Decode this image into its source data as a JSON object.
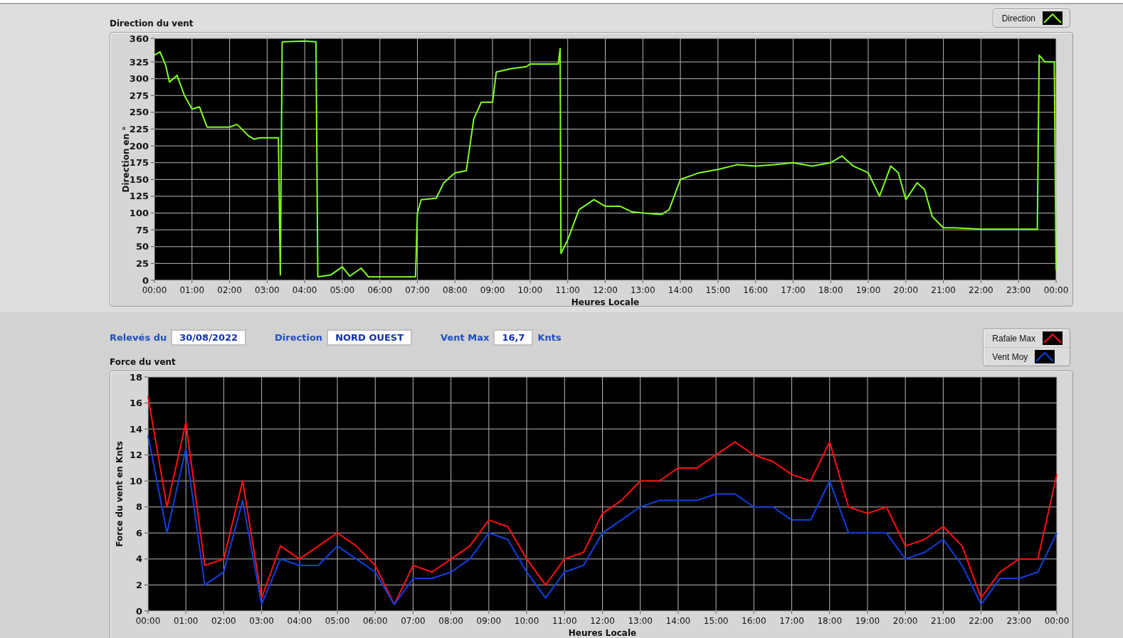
{
  "direction_chart": {
    "title": "Direction du vent",
    "chart_data": {
      "type": "line",
      "grid": true,
      "xlabel": "Heures Locale",
      "ylabel": "Direction en °",
      "xlim": [
        0,
        24
      ],
      "ylim": [
        0,
        360
      ],
      "yticks": [
        0,
        25,
        50,
        75,
        100,
        125,
        150,
        175,
        200,
        225,
        250,
        275,
        300,
        325,
        360
      ],
      "xticks": [
        {
          "value": 0,
          "label": "00:00"
        },
        {
          "value": 1,
          "label": "01:00"
        },
        {
          "value": 2,
          "label": "02:00"
        },
        {
          "value": 3,
          "label": "03:00"
        },
        {
          "value": 4,
          "label": "04:00"
        },
        {
          "value": 5,
          "label": "05:00"
        },
        {
          "value": 6,
          "label": "06:00"
        },
        {
          "value": 7,
          "label": "07:00"
        },
        {
          "value": 8,
          "label": "08:00"
        },
        {
          "value": 9,
          "label": "09:00"
        },
        {
          "value": 10,
          "label": "10:00"
        },
        {
          "value": 11,
          "label": "11:00"
        },
        {
          "value": 12,
          "label": "12:00"
        },
        {
          "value": 13,
          "label": "13:00"
        },
        {
          "value": 14,
          "label": "14:00"
        },
        {
          "value": 15,
          "label": "15:00"
        },
        {
          "value": 16,
          "label": "16:00"
        },
        {
          "value": 17,
          "label": "17:00"
        },
        {
          "value": 18,
          "label": "18:00"
        },
        {
          "value": 19,
          "label": "19:00"
        },
        {
          "value": 20,
          "label": "20:00"
        },
        {
          "value": 21,
          "label": "21:00"
        },
        {
          "value": 22,
          "label": "22:00"
        },
        {
          "value": 23,
          "label": "23:00"
        },
        {
          "value": 24,
          "label": "00:00"
        }
      ],
      "x": [
        0,
        0.15,
        0.3,
        0.4,
        0.6,
        0.8,
        1.0,
        1.2,
        1.4,
        2.0,
        2.2,
        2.5,
        2.65,
        2.8,
        3.3,
        3.35,
        3.4,
        4.0,
        4.3,
        4.35,
        4.7,
        5.0,
        5.2,
        5.5,
        5.7,
        6.95,
        7.0,
        7.1,
        7.5,
        7.7,
        8.0,
        8.3,
        8.5,
        8.7,
        9.0,
        9.1,
        9.5,
        9.9,
        10.0,
        10.75,
        10.8,
        10.82,
        11.0,
        11.3,
        11.7,
        12.0,
        12.4,
        12.7,
        13.0,
        13.5,
        13.7,
        14.0,
        14.5,
        15.0,
        15.5,
        16.0,
        16.5,
        17.0,
        17.5,
        18.0,
        18.3,
        18.6,
        19.0,
        19.3,
        19.6,
        19.8,
        20.0,
        20.3,
        20.5,
        20.7,
        21.0,
        21.3,
        22.0,
        23.0,
        23.5,
        23.55,
        23.7,
        23.95,
        24.0
      ],
      "series": [
        {
          "name": "Direction",
          "color": "#80ff20",
          "values": [
            335,
            340,
            320,
            295,
            305,
            275,
            255,
            258,
            228,
            228,
            232,
            215,
            210,
            212,
            212,
            8,
            355,
            356,
            355,
            5,
            8,
            20,
            6,
            18,
            5,
            5,
            100,
            120,
            122,
            145,
            160,
            163,
            240,
            265,
            265,
            310,
            315,
            318,
            322,
            322,
            345,
            40,
            60,
            105,
            120,
            110,
            110,
            102,
            100,
            98,
            105,
            150,
            160,
            165,
            172,
            170,
            172,
            175,
            170,
            175,
            185,
            170,
            160,
            125,
            170,
            160,
            120,
            145,
            135,
            95,
            78,
            78,
            76,
            76,
            76,
            335,
            325,
            325,
            15
          ]
        }
      ]
    }
  },
  "summary": {
    "fields": [
      {
        "label": "Relevés du",
        "value": "30/08/2022"
      },
      {
        "label": "Direction",
        "value": "NORD OUEST"
      },
      {
        "label": "Vent Max",
        "value": "16,7",
        "unit": "Knts"
      }
    ]
  },
  "force_chart": {
    "title": "Force du vent",
    "chart_data": {
      "type": "line",
      "grid": true,
      "xlabel": "Heures Locale",
      "ylabel": "Force du vent en Knts",
      "xlim": [
        0,
        24
      ],
      "ylim": [
        0,
        18
      ],
      "yticks": [
        0,
        2,
        4,
        6,
        8,
        10,
        12,
        14,
        16,
        18
      ],
      "xticks": [
        {
          "value": 0,
          "label": "00:00"
        },
        {
          "value": 1,
          "label": "01:00"
        },
        {
          "value": 2,
          "label": "02:00"
        },
        {
          "value": 3,
          "label": "03:00"
        },
        {
          "value": 4,
          "label": "04:00"
        },
        {
          "value": 5,
          "label": "05:00"
        },
        {
          "value": 6,
          "label": "06:00"
        },
        {
          "value": 7,
          "label": "07:00"
        },
        {
          "value": 8,
          "label": "08:00"
        },
        {
          "value": 9,
          "label": "09:00"
        },
        {
          "value": 10,
          "label": "10:00"
        },
        {
          "value": 11,
          "label": "11:00"
        },
        {
          "value": 12,
          "label": "12:00"
        },
        {
          "value": 13,
          "label": "13:00"
        },
        {
          "value": 14,
          "label": "14:00"
        },
        {
          "value": 15,
          "label": "15:00"
        },
        {
          "value": 16,
          "label": "16:00"
        },
        {
          "value": 17,
          "label": "17:00"
        },
        {
          "value": 18,
          "label": "18:00"
        },
        {
          "value": 19,
          "label": "19:00"
        },
        {
          "value": 20,
          "label": "20:00"
        },
        {
          "value": 21,
          "label": "21:00"
        },
        {
          "value": 22,
          "label": "22:00"
        },
        {
          "value": 23,
          "label": "23:00"
        },
        {
          "value": 24,
          "label": "00:00"
        }
      ],
      "x": [
        0,
        0.5,
        1,
        1.5,
        2,
        2.5,
        3,
        3.5,
        4,
        4.5,
        5,
        5.5,
        6,
        6.5,
        7,
        7.5,
        8,
        8.5,
        9,
        9.5,
        10,
        10.5,
        11,
        11.5,
        12,
        12.5,
        13,
        13.5,
        14,
        14.5,
        15,
        15.5,
        16,
        16.5,
        17,
        17.5,
        18,
        18.5,
        19,
        19.5,
        20,
        20.5,
        21,
        21.5,
        22,
        22.5,
        23,
        23.5,
        24
      ],
      "series": [
        {
          "name": "Rafale Max",
          "color": "#ff1010",
          "values": [
            16.5,
            8,
            14.5,
            3.5,
            4,
            10,
            1,
            5,
            4,
            5,
            6,
            5,
            3.5,
            0.5,
            3.5,
            3,
            4,
            5,
            7,
            6.5,
            4,
            2,
            4,
            4.5,
            7.5,
            8.5,
            10,
            10,
            11,
            11,
            12,
            13,
            12,
            11.5,
            10.5,
            10,
            13,
            8,
            7.5,
            8,
            5,
            5.5,
            6.5,
            5,
            1,
            3,
            4,
            4,
            10.5
          ]
        },
        {
          "name": "Vent Moy",
          "color": "#1040e0",
          "values": [
            13.5,
            6,
            12.5,
            2,
            3,
            8.5,
            0.5,
            4,
            3.5,
            3.5,
            5,
            4,
            3,
            0.5,
            2.5,
            2.5,
            3,
            4,
            6,
            5.5,
            3,
            1,
            3,
            3.5,
            6,
            7,
            8,
            8.5,
            8.5,
            8.5,
            9,
            9,
            8,
            8,
            7,
            7,
            10,
            6,
            6,
            6,
            4,
            4.5,
            5.5,
            3.5,
            0.5,
            2.5,
            2.5,
            3,
            6
          ]
        }
      ]
    }
  }
}
